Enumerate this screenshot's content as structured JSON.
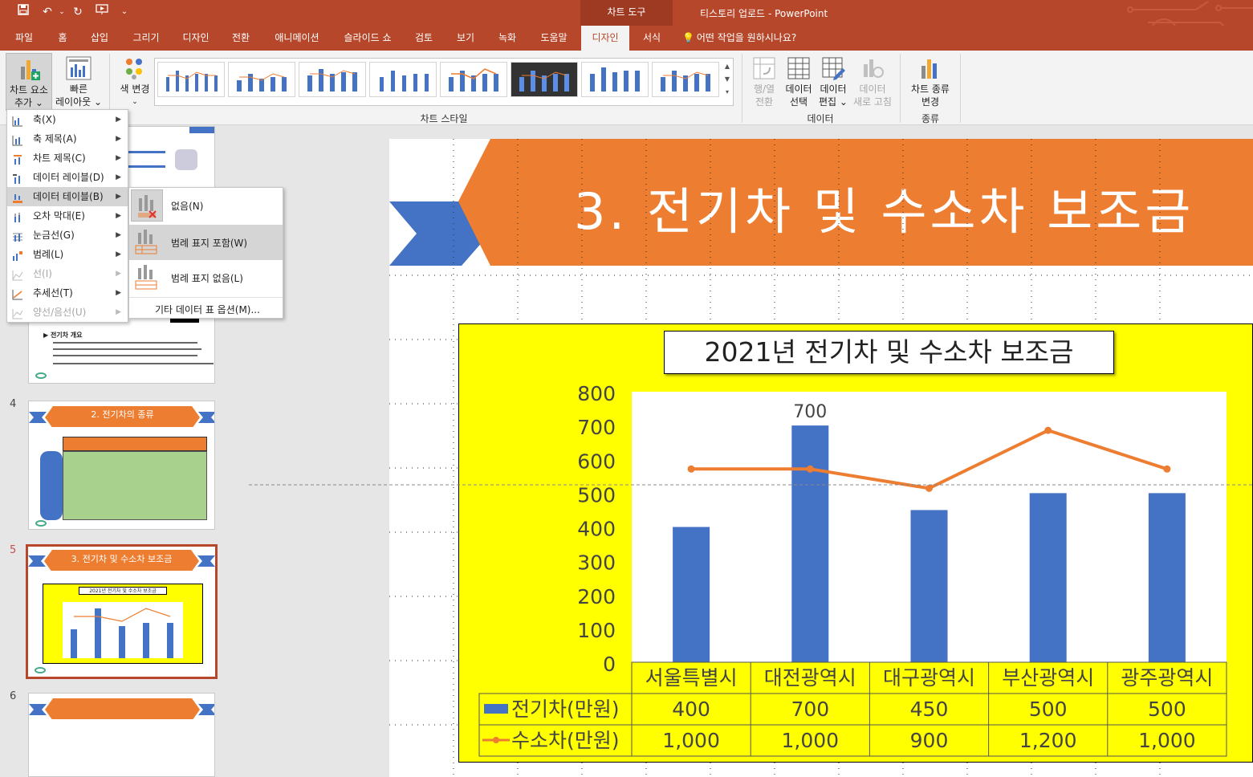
{
  "titlebar": {
    "context_tab": "차트 도구",
    "title": "티스토리 업로드",
    "separator": "-",
    "app": "PowerPoint",
    "qa_more": "⌄"
  },
  "tabs": [
    "파일",
    "홈",
    "삽입",
    "그리기",
    "디자인",
    "전환",
    "애니메이션",
    "슬라이드 쇼",
    "검토",
    "보기",
    "녹화",
    "도움말",
    "디자인",
    "서식"
  ],
  "active_tab_index": 12,
  "tell_me": "어떤 작업을 원하시나요?",
  "ribbon": {
    "add_element": [
      "차트 요소",
      "추가 ⌄"
    ],
    "quick_layout": [
      "빠른",
      "레이아웃 ⌄"
    ],
    "change_colors": [
      "색 변경",
      "⌄"
    ],
    "chart_styles_label": "차트 스타일",
    "switch_row_col": [
      "행/열",
      "전환"
    ],
    "select_data": [
      "데이터",
      "선택"
    ],
    "edit_data": [
      "데이터",
      "편집 ⌄"
    ],
    "refresh_data": [
      "데이터",
      "새로 고침"
    ],
    "data_group": "데이터",
    "change_type": [
      "차트 종류",
      "변경"
    ],
    "type_group": "종류"
  },
  "menu": {
    "items": [
      {
        "label": "축(X)",
        "disabled": false
      },
      {
        "label": "축 제목(A)",
        "disabled": false
      },
      {
        "label": "차트 제목(C)",
        "disabled": false
      },
      {
        "label": "데이터 레이블(D)",
        "disabled": false
      },
      {
        "label": "데이터 테이블(B)",
        "disabled": false
      },
      {
        "label": "오차 막대(E)",
        "disabled": false
      },
      {
        "label": "눈금선(G)",
        "disabled": false
      },
      {
        "label": "범례(L)",
        "disabled": false
      },
      {
        "label": "선(I)",
        "disabled": true
      },
      {
        "label": "추세선(T)",
        "disabled": false
      },
      {
        "label": "양선/음선(U)",
        "disabled": true
      }
    ],
    "highlighted": 4
  },
  "submenu": {
    "items": [
      "없음(N)",
      "범례 표지 포함(W)",
      "범례 표지 없음(L)"
    ],
    "more": "기타 데이터 표 옵션(M)...",
    "highlighted": 1
  },
  "slides": {
    "nums": [
      "4",
      "5",
      "6"
    ],
    "slide4_title": "2. 전기차의 종류",
    "slide5_title": "3. 전기차 및 수소차 보조금",
    "slide5_chart_title": "2021년 전기차 및 수소차 보조금",
    "slide3_heading": "전기차 개요"
  },
  "slide": {
    "title": "3. 전기차 및 수소차 보조금"
  },
  "chart_data": {
    "type": "bar",
    "title": "2021년 전기차 및 수소차 보조금",
    "categories": [
      "서울특별시",
      "대전광역시",
      "대구광역시",
      "부산광역시",
      "광주광역시"
    ],
    "series": [
      {
        "name": "전기차(만원)",
        "type": "bar",
        "values": [
          400,
          700,
          450,
          500,
          500
        ],
        "display": [
          "400",
          "700",
          "450",
          "500",
          "500"
        ],
        "color": "#4472c4"
      },
      {
        "name": "수소차(만원)",
        "type": "line",
        "axis": "secondary",
        "values": [
          1000,
          1000,
          900,
          1200,
          1000
        ],
        "display": [
          "1,000",
          "1,000",
          "900",
          "1,200",
          "1,000"
        ],
        "color": "#ed7d31"
      }
    ],
    "y_ticks": [
      "800",
      "700",
      "600",
      "500",
      "400",
      "300",
      "200",
      "100",
      "0"
    ],
    "ylim": [
      0,
      800
    ],
    "y2lim": [
      0,
      1400
    ],
    "data_label": {
      "series": 0,
      "index": 1,
      "text": "700"
    },
    "background": "#ffff00",
    "data_table": true
  },
  "colors": {
    "accent": "#b7472a",
    "orange": "#ed7d31",
    "blue": "#4472c4",
    "chart_bg": "#ffff00"
  }
}
